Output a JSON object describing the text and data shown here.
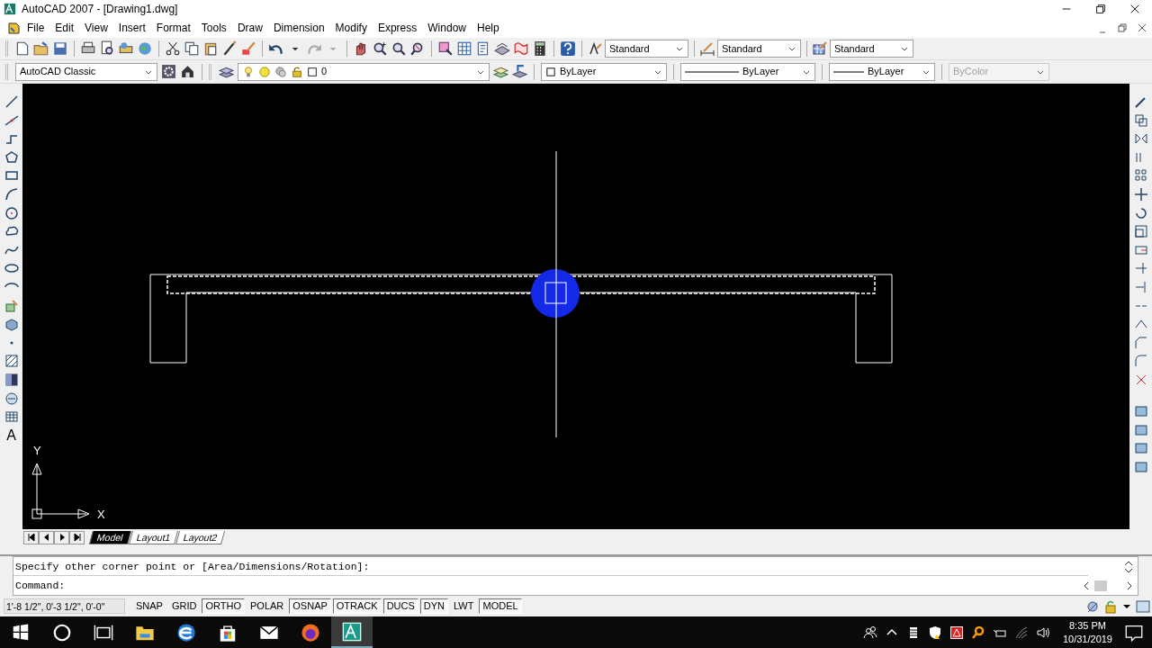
{
  "window": {
    "title": "AutoCAD 2007 - [Drawing1.dwg]"
  },
  "menu": [
    "File",
    "Edit",
    "View",
    "Insert",
    "Format",
    "Tools",
    "Draw",
    "Dimension",
    "Modify",
    "Express",
    "Window",
    "Help"
  ],
  "styles_toolbar": {
    "text_style": "Standard",
    "dim_style": "Standard",
    "table_style": "Standard"
  },
  "layers_toolbar": {
    "workspace": "AutoCAD Classic",
    "layer": "0"
  },
  "properties_toolbar": [
    {
      "kind": "color",
      "value": "ByLayer",
      "disabled": false
    },
    {
      "kind": "linetype",
      "value": "ByLayer",
      "disabled": false
    },
    {
      "kind": "lineweight",
      "value": "ByLayer",
      "disabled": false
    },
    {
      "kind": "plot_style",
      "value": "ByColor",
      "disabled": true
    }
  ],
  "draw_toolbar": {
    "mtext_glyph": "A"
  },
  "ucs_icon": {
    "x_label": "X",
    "y_label": "Y"
  },
  "layout_tabs": [
    {
      "label": "Model",
      "selected": true
    },
    {
      "label": "Layout1",
      "selected": false
    },
    {
      "label": "Layout2",
      "selected": false
    }
  ],
  "command_line": {
    "history": "Specify other corner point or [Area/Dimensions/Rotation]:",
    "prompt": "Command:"
  },
  "status_bar": {
    "coordinates": "1'-8 1/2\", 0'-3 1/2\", 0'-0\"",
    "toggles": [
      {
        "label": "SNAP",
        "on": false
      },
      {
        "label": "GRID",
        "on": false
      },
      {
        "label": "ORTHO",
        "on": true
      },
      {
        "label": "POLAR",
        "on": false
      },
      {
        "label": "OSNAP",
        "on": true
      },
      {
        "label": "OTRACK",
        "on": true
      },
      {
        "label": "DUCS",
        "on": true
      },
      {
        "label": "DYN",
        "on": true
      },
      {
        "label": "LWT",
        "on": false
      },
      {
        "label": "MODEL",
        "on": true
      }
    ]
  },
  "taskbar": {
    "time": "8:35 PM",
    "date": "10/31/2019"
  }
}
